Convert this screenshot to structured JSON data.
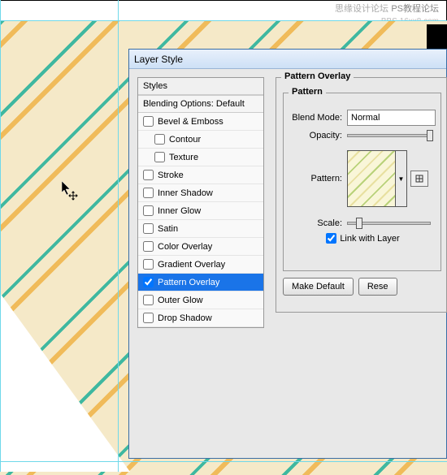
{
  "watermark": {
    "line1": "思缘设计论坛",
    "line2": "PS教程论坛",
    "line3": "BBS.16xx8.com"
  },
  "dialog": {
    "title": "Layer Style"
  },
  "styles": {
    "header": "Styles",
    "subheader": "Blending Options: Default",
    "items": [
      {
        "label": "Bevel & Emboss",
        "checked": false,
        "indent": false
      },
      {
        "label": "Contour",
        "checked": false,
        "indent": true
      },
      {
        "label": "Texture",
        "checked": false,
        "indent": true
      },
      {
        "label": "Stroke",
        "checked": false,
        "indent": false
      },
      {
        "label": "Inner Shadow",
        "checked": false,
        "indent": false
      },
      {
        "label": "Inner Glow",
        "checked": false,
        "indent": false
      },
      {
        "label": "Satin",
        "checked": false,
        "indent": false
      },
      {
        "label": "Color Overlay",
        "checked": false,
        "indent": false
      },
      {
        "label": "Gradient Overlay",
        "checked": false,
        "indent": false
      },
      {
        "label": "Pattern Overlay",
        "checked": true,
        "indent": false,
        "selected": true
      },
      {
        "label": "Outer Glow",
        "checked": false,
        "indent": false
      },
      {
        "label": "Drop Shadow",
        "checked": false,
        "indent": false
      }
    ]
  },
  "patternOverlay": {
    "groupLabel": "Pattern Overlay",
    "subgroupLabel": "Pattern",
    "blendModeLabel": "Blend Mode:",
    "blendModeValue": "Normal",
    "opacityLabel": "Opacity:",
    "patternLabel": "Pattern:",
    "scaleLabel": "Scale:",
    "linkLabel": "Link with Layer",
    "linkChecked": true,
    "makeDefault": "Make Default",
    "reset": "Rese"
  }
}
